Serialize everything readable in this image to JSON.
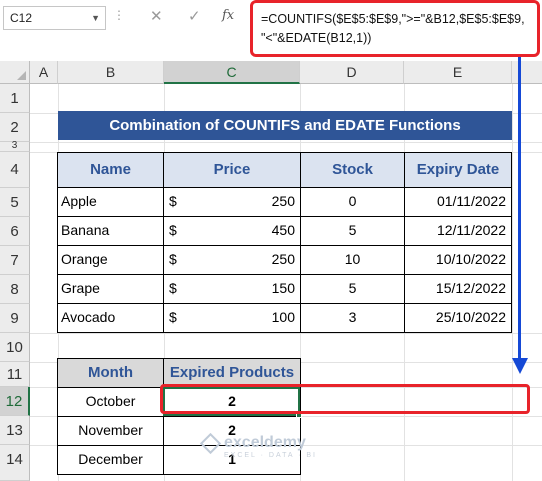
{
  "name_box": {
    "value": "C12"
  },
  "formula_bar": {
    "fx": "fx",
    "formula": "=COUNTIFS($E$5:$E$9,\">=\"&B12,$E$5:$E$9,\n\"<\"&EDATE(B12,1))"
  },
  "columns": [
    "A",
    "B",
    "C",
    "D",
    "E"
  ],
  "rows": [
    "1",
    "2",
    "3",
    "4",
    "5",
    "6",
    "7",
    "8",
    "9",
    "10",
    "11",
    "12",
    "13",
    "14"
  ],
  "selected_cell": {
    "column": "C",
    "row": "12"
  },
  "title": "Combination of COUNTIFS and EDATE Functions",
  "main_table": {
    "headers": [
      "Name",
      "Price",
      "Stock",
      "Expiry Date"
    ],
    "currency": "$",
    "rows": [
      {
        "name": "Apple",
        "price": "250",
        "stock": "0",
        "expiry": "01/11/2022"
      },
      {
        "name": "Banana",
        "price": "450",
        "stock": "5",
        "expiry": "12/11/2022"
      },
      {
        "name": "Orange",
        "price": "250",
        "stock": "10",
        "expiry": "10/10/2022"
      },
      {
        "name": "Grape",
        "price": "150",
        "stock": "5",
        "expiry": "15/12/2022"
      },
      {
        "name": "Avocado",
        "price": "100",
        "stock": "3",
        "expiry": "25/10/2022"
      }
    ]
  },
  "result_table": {
    "headers": [
      "Month",
      "Expired Products"
    ],
    "rows": [
      {
        "month": "October",
        "count": "2"
      },
      {
        "month": "November",
        "count": "2"
      },
      {
        "month": "December",
        "count": "1"
      }
    ]
  },
  "watermark": {
    "brand": "exceldemy",
    "tagline": "EXCEL · DATA · BI"
  },
  "colors": {
    "title_bg": "#2f5597",
    "header_text": "#2f5597",
    "header_bg": "#dbe3f0",
    "callout_red": "#e8232a",
    "arrow_blue": "#1549d6",
    "selection_green": "#217346"
  }
}
